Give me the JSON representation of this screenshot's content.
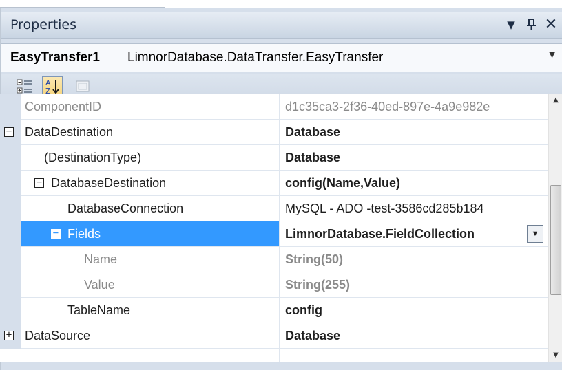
{
  "panel": {
    "title": "Properties",
    "controls": {
      "dropdown_glyph": "▾",
      "pin_glyph": "ᵖ",
      "close_glyph": "✕"
    }
  },
  "selector": {
    "object_name": "EasyTransfer1",
    "object_type": "LimnorDatabase.DataTransfer.EasyTransfer"
  },
  "toolbar": {
    "buttons": [
      "categorized-icon",
      "alphabetical-icon",
      "property-pages-icon"
    ],
    "active": "alphabetical"
  },
  "grid": {
    "rows": [
      {
        "name": "ComponentID",
        "value": "d1c35ca3-2f36-40ed-897e-4a9e982e",
        "expander": "",
        "name_style": "gray",
        "value_style": "gray"
      },
      {
        "name": "DataDestination",
        "value": "Database",
        "expander": "⊟",
        "name_style": "",
        "value_style": "bold"
      },
      {
        "name": "(DestinationType)",
        "value": "Database",
        "expander": "",
        "name_style": "",
        "value_style": "bold"
      },
      {
        "name": "DatabaseDestination",
        "value": "config(Name,Value)",
        "expander": "⊟",
        "name_style": "",
        "value_style": "bold"
      },
      {
        "name": "DatabaseConnection",
        "value": "MySQL - ADO -test-3586cd285b184",
        "expander": "",
        "name_style": "",
        "value_style": ""
      },
      {
        "name": "Fields",
        "value": "LimnorDatabase.FieldCollection",
        "expander": "⊟",
        "name_style": "",
        "value_style": "bold",
        "selected": true
      },
      {
        "name": "Name",
        "value": "String(50)",
        "expander": "",
        "name_style": "gray",
        "value_style": "gray bold"
      },
      {
        "name": "Value",
        "value": "String(255)",
        "expander": "",
        "name_style": "gray",
        "value_style": "gray bold"
      },
      {
        "name": "TableName",
        "value": "config",
        "expander": "",
        "name_style": "",
        "value_style": "bold"
      },
      {
        "name": "DataSource",
        "value": "Database",
        "expander": "⊞",
        "name_style": "",
        "value_style": "bold"
      }
    ]
  },
  "colors": {
    "selection": "#3399ff",
    "panel_bg": "#d6dfeb"
  }
}
